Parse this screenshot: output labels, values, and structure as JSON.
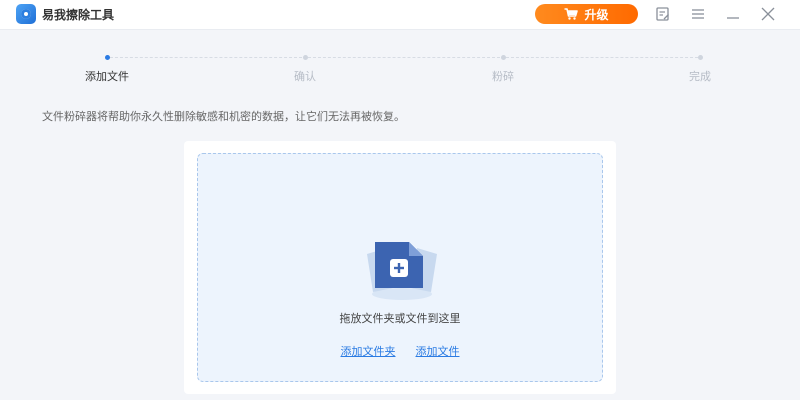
{
  "app": {
    "title": "易我擦除工具",
    "upgrade_label": "升级"
  },
  "titlebar_icons": [
    "notes-icon",
    "menu-icon",
    "minimize-icon",
    "close-icon"
  ],
  "steps": [
    {
      "label": "添加文件",
      "active": true
    },
    {
      "label": "确认",
      "active": false
    },
    {
      "label": "粉碎",
      "active": false
    },
    {
      "label": "完成",
      "active": false
    }
  ],
  "description": "文件粉碎器将帮助你永久性删除敏感和机密的数据，让它们无法再被恢复。",
  "dropzone": {
    "instruction": "拖放文件夹或文件到这里",
    "add_folder_link": "添加文件夹",
    "add_file_link": "添加文件"
  },
  "colors": {
    "accent": "#2b7be3",
    "upgrade": "#ff7a12",
    "dropzone_bg": "#edf4fd"
  }
}
